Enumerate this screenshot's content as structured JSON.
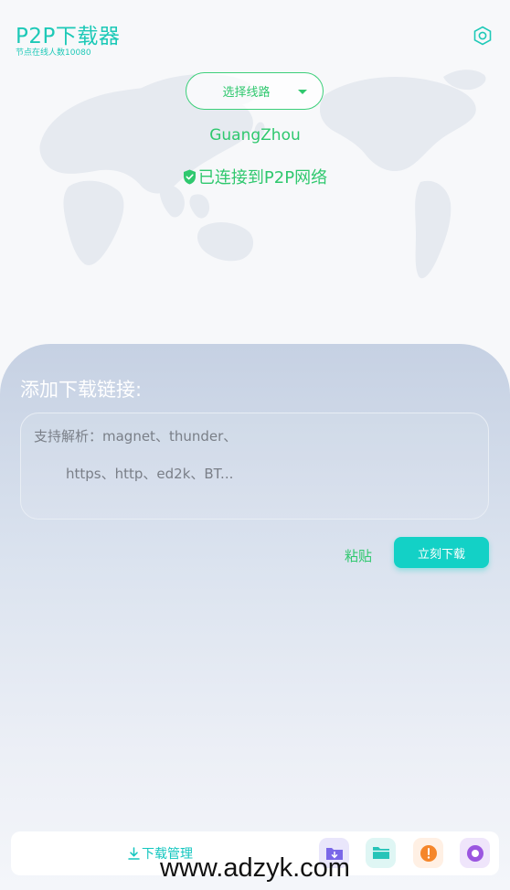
{
  "header": {
    "title": "P2P下载器",
    "subtitle": "节点在线人数10080",
    "settings_icon": "hexagon-settings-icon"
  },
  "server": {
    "selector_label": "选择线路",
    "location": "GuangZhou",
    "status": "已连接到P2P网络"
  },
  "panel": {
    "title": "添加下载链接:",
    "placeholder_line1": "支持解析：magnet、thunder、",
    "placeholder_line2": "https、http、ed2k、BT...",
    "paste_label": "粘贴",
    "download_label": "立刻下载"
  },
  "bottom_bar": {
    "manage_label": "下载管理",
    "icons": [
      "folder-download-icon",
      "folder-icon",
      "alert-icon",
      "record-icon"
    ]
  },
  "colors": {
    "accent": "#1dc9b7",
    "green": "#2fc86e",
    "button": "#13d1c6"
  },
  "watermark": "www.adzyk.com"
}
